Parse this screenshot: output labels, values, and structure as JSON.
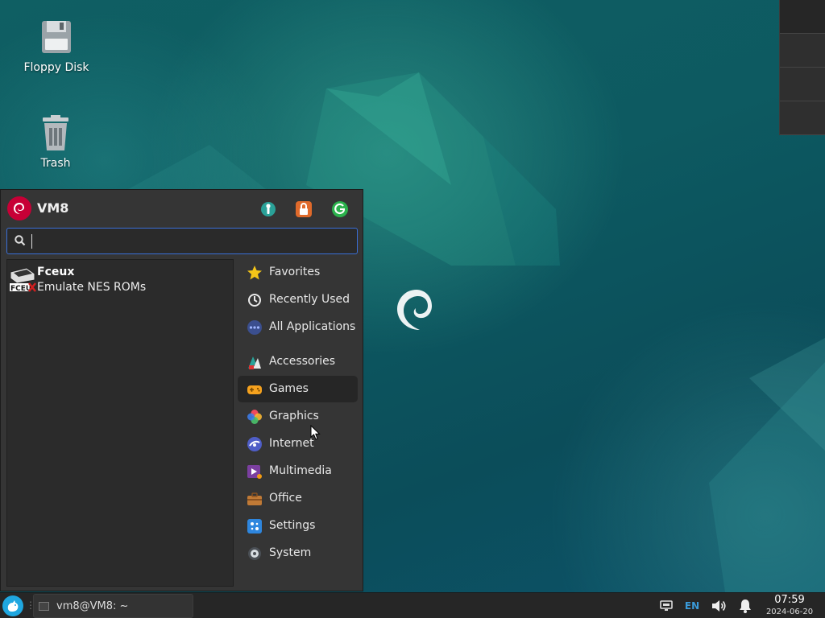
{
  "desktop": {
    "icons": [
      {
        "label": "Floppy Disk",
        "icon": "floppy-disk-icon"
      },
      {
        "label": "Trash",
        "icon": "trash-icon"
      }
    ]
  },
  "menu": {
    "username": "VM8",
    "header_buttons": [
      {
        "name": "settings-manager-icon",
        "color": "#2aa198"
      },
      {
        "name": "lock-screen-icon",
        "color": "#e06a2b"
      },
      {
        "name": "logout-icon",
        "color": "#2bb24c"
      }
    ],
    "search": {
      "value": "",
      "placeholder": ""
    },
    "results": [
      {
        "name": "Fceux",
        "description": "Emulate NES ROMs"
      }
    ],
    "categories": [
      {
        "label": "Favorites",
        "icon": "star-icon"
      },
      {
        "label": "Recently Used",
        "icon": "clock-icon"
      },
      {
        "label": "All Applications",
        "icon": "applications-icon"
      },
      {
        "label": "Accessories",
        "icon": "accessories-icon"
      },
      {
        "label": "Games",
        "icon": "gamepad-icon",
        "selected": true
      },
      {
        "label": "Graphics",
        "icon": "graphics-icon"
      },
      {
        "label": "Internet",
        "icon": "internet-icon"
      },
      {
        "label": "Multimedia",
        "icon": "multimedia-icon"
      },
      {
        "label": "Office",
        "icon": "briefcase-icon"
      },
      {
        "label": "Settings",
        "icon": "settings-icon"
      },
      {
        "label": "System",
        "icon": "system-icon"
      }
    ]
  },
  "taskbar": {
    "tasks": [
      {
        "label": "vm8@VM8: ~",
        "icon": "terminal-icon"
      }
    ],
    "tray": {
      "language": "EN",
      "time": "07:59",
      "date": "2024-06-20"
    }
  },
  "colors": {
    "accent": "#3a6fd8",
    "debian_red": "#c70036"
  }
}
